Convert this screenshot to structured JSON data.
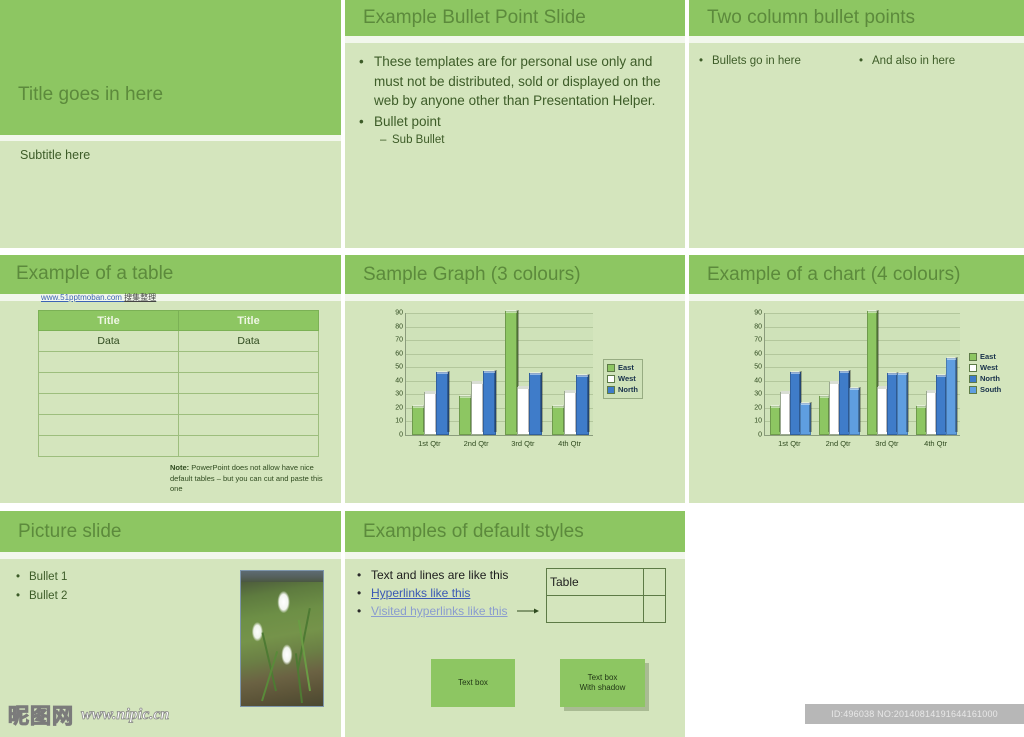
{
  "theme": {
    "band_green": "#8dc662",
    "slide_bg": "#d4e5bd",
    "title_text": "#5c8a3c",
    "body_text": "#3d5c28"
  },
  "slides": {
    "title_slide": {
      "title": "Title goes in here",
      "subtitle": "Subtitle here"
    },
    "bullet_slide": {
      "title": "Example Bullet Point Slide",
      "bullets": [
        "These templates are for personal use only and must not be distributed, sold or displayed on the web by anyone other than Presentation Helper.",
        "Bullet point"
      ],
      "sub_bullet": "Sub Bullet",
      "bullet_glyph": "•",
      "sub_glyph": "–"
    },
    "two_column_slide": {
      "title": "Two column bullet points",
      "left_bullet": "Bullets go in here",
      "right_bullet": "And also in here",
      "bullet_glyph": "•"
    },
    "table_slide": {
      "title": "Example of a table",
      "headers": [
        "Title",
        "Title"
      ],
      "first_row": [
        "Data",
        "Data"
      ],
      "empty_rows": 5,
      "note_label": "Note:",
      "note_text": "PowerPoint does not allow have nice default tables – but you can cut and paste this one"
    },
    "graph_slide": {
      "title": "Sample Graph (3 colours)"
    },
    "chart_slide": {
      "title": "Example of a chart (4 colours)"
    },
    "picture_slide": {
      "title": "Picture slide",
      "bullets": [
        "Bullet 1",
        "Bullet 2"
      ],
      "bullet_glyph": "•",
      "image_alt": "snowdrop-flowers-photo"
    },
    "styles_slide": {
      "title": "Examples of default styles",
      "bullet_glyph": "•",
      "text_line": "Text and lines are like this",
      "hyperlink": "Hyperlinks like this",
      "visited_hyperlink": "Visited hyperlinks like this",
      "table_label": "Table",
      "text_box": "Text box",
      "text_box_shadow_line1": "Text box",
      "text_box_shadow_line2": "With shadow"
    }
  },
  "watermarks": {
    "site_cn_url": "www.51pptmoban.com",
    "site_cn_text": "搜集整理",
    "nipic_logo": "昵图网",
    "nipic_url": "www.nipic.cn",
    "id_text": "ID:496038 NO:20140814191644161000"
  },
  "chart_data": [
    {
      "type": "bar",
      "title": "Sample Graph (3 colours)",
      "categories": [
        "1st Qtr",
        "2nd Qtr",
        "3rd Qtr",
        "4th Qtr"
      ],
      "series": [
        {
          "name": "East",
          "values": [
            20,
            27,
            90,
            20
          ],
          "color": "#8dc662"
        },
        {
          "name": "West",
          "values": [
            30,
            38,
            34,
            31
          ],
          "color": "#ffffff"
        },
        {
          "name": "North",
          "values": [
            45,
            46,
            44,
            43
          ],
          "color": "#3f7cc9"
        }
      ],
      "ylim": [
        0,
        90
      ],
      "yticks": [
        0,
        10,
        20,
        30,
        40,
        50,
        60,
        70,
        80,
        90
      ],
      "xlabel": "",
      "ylabel": "",
      "grid": true,
      "legend_position": "right"
    },
    {
      "type": "bar",
      "title": "Example of a chart (4 colours)",
      "categories": [
        "1st Qtr",
        "2nd Qtr",
        "3rd Qtr",
        "4th Qtr"
      ],
      "series": [
        {
          "name": "East",
          "values": [
            20,
            27,
            90,
            20
          ],
          "color": "#8dc662"
        },
        {
          "name": "West",
          "values": [
            30,
            38,
            34,
            31
          ],
          "color": "#ffffff"
        },
        {
          "name": "North",
          "values": [
            45,
            46,
            44,
            43
          ],
          "color": "#3f7cc9"
        },
        {
          "name": "South",
          "values": [
            22,
            33,
            44,
            55
          ],
          "color": "#5f9ee0"
        }
      ],
      "ylim": [
        0,
        90
      ],
      "yticks": [
        0,
        10,
        20,
        30,
        40,
        50,
        60,
        70,
        80,
        90
      ],
      "xlabel": "",
      "ylabel": "",
      "grid": true,
      "legend_position": "right"
    }
  ]
}
